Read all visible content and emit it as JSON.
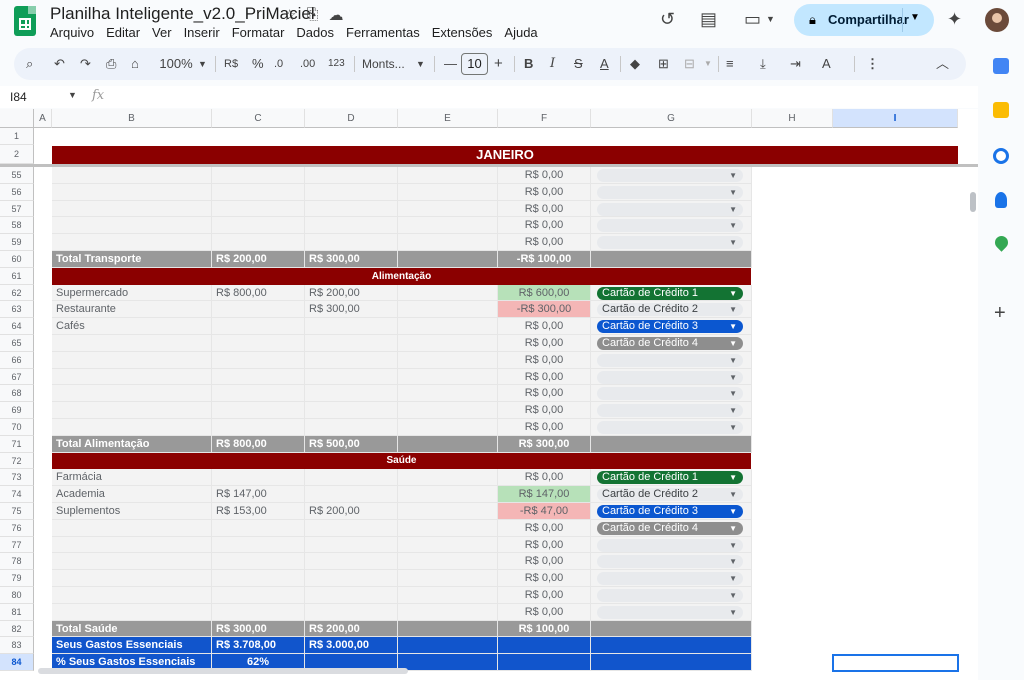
{
  "header": {
    "doc_title": "Planilha Inteligente_v2.0_PriMaciel",
    "menus": [
      "Arquivo",
      "Editar",
      "Ver",
      "Inserir",
      "Formatar",
      "Dados",
      "Ferramentas",
      "Extensões",
      "Ajuda"
    ],
    "share_label": "Compartilhar"
  },
  "toolbar": {
    "zoom": "100%",
    "currency": "R$",
    "percent": "%",
    "dec_less": ".0",
    "dec_more": ".00",
    "number_format": "123",
    "font": "Monts...",
    "font_size": "10"
  },
  "formula_bar": {
    "cell_ref": "I84",
    "fx": "fx"
  },
  "columns": [
    "A",
    "B",
    "C",
    "D",
    "E",
    "F",
    "G",
    "H",
    "I"
  ],
  "selected_column": "I",
  "frozen_rows": [
    {
      "num": "1",
      "text": ""
    },
    {
      "num": "2",
      "text": "JANEIRO"
    }
  ],
  "rows": [
    {
      "num": "55",
      "b": "",
      "c": "",
      "d": "",
      "f": "R$ 0,00",
      "g": "",
      "style": "plain",
      "fstyle": "",
      "pill": "empty"
    },
    {
      "num": "56",
      "b": "",
      "c": "",
      "d": "",
      "f": "R$ 0,00",
      "g": "",
      "style": "plain",
      "fstyle": "",
      "pill": "empty"
    },
    {
      "num": "57",
      "b": "",
      "c": "",
      "d": "",
      "f": "R$ 0,00",
      "g": "",
      "style": "plain",
      "fstyle": "",
      "pill": "empty"
    },
    {
      "num": "58",
      "b": "",
      "c": "",
      "d": "",
      "f": "R$ 0,00",
      "g": "",
      "style": "plain",
      "fstyle": "",
      "pill": "empty"
    },
    {
      "num": "59",
      "b": "",
      "c": "",
      "d": "",
      "f": "R$ 0,00",
      "g": "",
      "style": "plain",
      "fstyle": "",
      "pill": "empty"
    },
    {
      "num": "60",
      "b": "Total Transporte",
      "c": "R$ 200,00",
      "d": "R$ 300,00",
      "f": "-R$ 100,00",
      "g": "",
      "style": "total",
      "fstyle": "",
      "pill": "none"
    },
    {
      "num": "61",
      "b": "Alimentação",
      "c": "",
      "d": "",
      "f": "",
      "g": "",
      "style": "section",
      "fstyle": "",
      "pill": "none"
    },
    {
      "num": "62",
      "b": "Supermercado",
      "c": "R$ 800,00",
      "d": "R$ 200,00",
      "f": "R$ 600,00",
      "g": "Cartão de Crédito 1",
      "style": "plain",
      "fstyle": "green",
      "pill": "green"
    },
    {
      "num": "63",
      "b": "Restaurante",
      "c": "",
      "d": "R$ 300,00",
      "f": "-R$ 300,00",
      "g": "Cartão de Crédito 2",
      "style": "plain",
      "fstyle": "red",
      "pill": "light"
    },
    {
      "num": "64",
      "b": "Cafés",
      "c": "",
      "d": "",
      "f": "R$ 0,00",
      "g": "Cartão de Crédito 3",
      "style": "plain",
      "fstyle": "",
      "pill": "blue"
    },
    {
      "num": "65",
      "b": "",
      "c": "",
      "d": "",
      "f": "R$ 0,00",
      "g": "Cartão de Crédito 4",
      "style": "plain",
      "fstyle": "",
      "pill": "gray"
    },
    {
      "num": "66",
      "b": "",
      "c": "",
      "d": "",
      "f": "R$ 0,00",
      "g": "",
      "style": "plain",
      "fstyle": "",
      "pill": "empty"
    },
    {
      "num": "67",
      "b": "",
      "c": "",
      "d": "",
      "f": "R$ 0,00",
      "g": "",
      "style": "plain",
      "fstyle": "",
      "pill": "empty"
    },
    {
      "num": "68",
      "b": "",
      "c": "",
      "d": "",
      "f": "R$ 0,00",
      "g": "",
      "style": "plain",
      "fstyle": "",
      "pill": "empty"
    },
    {
      "num": "69",
      "b": "",
      "c": "",
      "d": "",
      "f": "R$ 0,00",
      "g": "",
      "style": "plain",
      "fstyle": "",
      "pill": "empty"
    },
    {
      "num": "70",
      "b": "",
      "c": "",
      "d": "",
      "f": "R$ 0,00",
      "g": "",
      "style": "plain",
      "fstyle": "",
      "pill": "empty"
    },
    {
      "num": "71",
      "b": "Total Alimentação",
      "c": "R$ 800,00",
      "d": "R$ 500,00",
      "f": "R$ 300,00",
      "g": "",
      "style": "total",
      "fstyle": "",
      "pill": "none"
    },
    {
      "num": "72",
      "b": "Saúde",
      "c": "",
      "d": "",
      "f": "",
      "g": "",
      "style": "section",
      "fstyle": "",
      "pill": "none"
    },
    {
      "num": "73",
      "b": "Farmácia",
      "c": "",
      "d": "",
      "f": "R$ 0,00",
      "g": "Cartão de Crédito 1",
      "style": "plain",
      "fstyle": "",
      "pill": "green"
    },
    {
      "num": "74",
      "b": "Academia",
      "c": "R$ 147,00",
      "d": "",
      "f": "R$ 147,00",
      "g": "Cartão de Crédito 2",
      "style": "plain",
      "fstyle": "green",
      "pill": "light"
    },
    {
      "num": "75",
      "b": "Suplementos",
      "c": "R$ 153,00",
      "d": "R$ 200,00",
      "f": "-R$ 47,00",
      "g": "Cartão de Crédito 3",
      "style": "plain",
      "fstyle": "red",
      "pill": "blue"
    },
    {
      "num": "76",
      "b": "",
      "c": "",
      "d": "",
      "f": "R$ 0,00",
      "g": "Cartão de Crédito 4",
      "style": "plain",
      "fstyle": "",
      "pill": "gray"
    },
    {
      "num": "77",
      "b": "",
      "c": "",
      "d": "",
      "f": "R$ 0,00",
      "g": "",
      "style": "plain",
      "fstyle": "",
      "pill": "empty"
    },
    {
      "num": "78",
      "b": "",
      "c": "",
      "d": "",
      "f": "R$ 0,00",
      "g": "",
      "style": "plain",
      "fstyle": "",
      "pill": "empty"
    },
    {
      "num": "79",
      "b": "",
      "c": "",
      "d": "",
      "f": "R$ 0,00",
      "g": "",
      "style": "plain",
      "fstyle": "",
      "pill": "empty"
    },
    {
      "num": "80",
      "b": "",
      "c": "",
      "d": "",
      "f": "R$ 0,00",
      "g": "",
      "style": "plain",
      "fstyle": "",
      "pill": "empty"
    },
    {
      "num": "81",
      "b": "",
      "c": "",
      "d": "",
      "f": "R$ 0,00",
      "g": "",
      "style": "plain",
      "fstyle": "",
      "pill": "empty"
    },
    {
      "num": "82",
      "b": "Total Saúde",
      "c": "R$ 300,00",
      "d": "R$ 200,00",
      "f": "R$ 100,00",
      "g": "",
      "style": "total",
      "fstyle": "",
      "pill": "none"
    },
    {
      "num": "83",
      "b": "Seus Gastos Essenciais",
      "c": "R$ 3.708,00",
      "d": "R$ 3.000,00",
      "f": "",
      "g": "",
      "style": "blue",
      "fstyle": "",
      "pill": "none"
    },
    {
      "num": "84",
      "b": "% Seus Gastos Essenciais",
      "c": "62%",
      "d": "",
      "f": "",
      "g": "",
      "style": "blue",
      "fstyle": "",
      "pill": "none"
    }
  ],
  "colors": {
    "header_red": "#8b0000",
    "total_gray": "#999999",
    "blue_band": "#1155cc",
    "green_fill": "#b7e1b9",
    "red_fill": "#f4b6b6",
    "pill_green": "#137333",
    "pill_blue": "#0b57d0",
    "pill_gray": "#8e8e8e",
    "pill_light": "#e8eaed",
    "accent": "#1a73e8"
  }
}
